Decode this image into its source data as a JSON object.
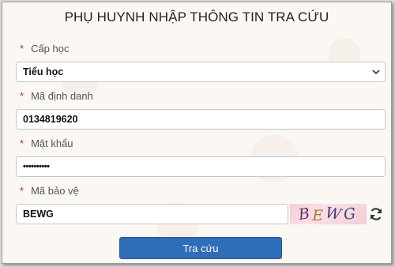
{
  "title": "PHỤ HUYNH NHẬP THÔNG TIN TRA CỨU",
  "required_marker": "*",
  "fields": {
    "level": {
      "label": "Cấp học",
      "value": "Tiểu học"
    },
    "id": {
      "label": "Mã định danh",
      "value": "0134819620"
    },
    "password": {
      "label": "Mật khẩu",
      "value": "••••••••••"
    },
    "captcha": {
      "label": "Mã bảo vệ",
      "value": "BEWG"
    }
  },
  "captcha_image_text": [
    "B",
    "E",
    "W",
    "G"
  ],
  "icons": {
    "dropdown": "chevron-down-icon",
    "refresh": "refresh-icon"
  },
  "submit_label": "Tra cứu",
  "colors": {
    "accent": "#2e6db7",
    "required": "#dd2222"
  }
}
